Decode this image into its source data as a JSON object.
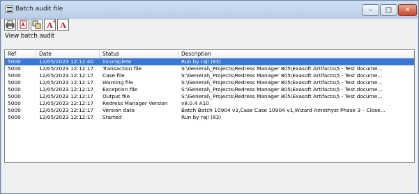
{
  "window": {
    "title": "Batch audit file"
  },
  "toolbar": {
    "buttons": [
      {
        "name": "print-button",
        "icon": "printer-icon"
      },
      {
        "name": "export-pdf-button",
        "icon": "pdf-icon"
      },
      {
        "name": "copy-button",
        "icon": "copy-icon"
      },
      {
        "name": "increase-font-button",
        "icon": "font-increase-icon",
        "glyph": "A",
        "sup": "+"
      },
      {
        "name": "decrease-font-button",
        "icon": "font-decrease-icon",
        "glyph": "A",
        "sup": "-"
      }
    ]
  },
  "caption": "View batch audit",
  "table": {
    "columns": [
      "Ref",
      "Date",
      "Status",
      "Description"
    ],
    "rows": [
      {
        "ref": "5000",
        "date": "12/05/2023 12:12:40",
        "status": "Incomplete",
        "description": "Run by raji (83)",
        "selected": true
      },
      {
        "ref": "5000",
        "date": "12/05/2023 12:12:17",
        "status": "Transaction file",
        "description": "S:\\General\\_Projects\\Redress Manager 805\\Exasoft Artifacts\\5 - Test docume…"
      },
      {
        "ref": "5000",
        "date": "12/05/2023 12:12:17",
        "status": "Case file",
        "description": "S:\\General\\_Projects\\Redress Manager 805\\Exasoft Artifacts\\5 - Test docume…"
      },
      {
        "ref": "5000",
        "date": "12/05/2023 12:12:17",
        "status": "Warning file",
        "description": "S:\\General\\_Projects\\Redress Manager 805\\Exasoft Artifacts\\5 - Test docume…"
      },
      {
        "ref": "5000",
        "date": "12/05/2023 12:12:17",
        "status": "Exception file",
        "description": "S:\\General\\_Projects\\Redress Manager 805\\Exasoft Artifacts\\5 - Test docume…"
      },
      {
        "ref": "5000",
        "date": "12/05/2023 12:12:17",
        "status": "Output file",
        "description": "S:\\General\\_Projects\\Redress Manager 805\\Exasoft Artifacts\\5 - Test docume…"
      },
      {
        "ref": "5000",
        "date": "12/05/2023 12:12:17",
        "status": "Redress Manager Version",
        "description": "v8.0.4 A10"
      },
      {
        "ref": "5000",
        "date": "12/05/2023 12:12:17",
        "status": "Version data",
        "description": "Batch Batch 10904 v3,Case Case 10904 v1,Wizard Amethyst Phase 3 – Close…"
      },
      {
        "ref": "5000",
        "date": "12/05/2023 12:12:17",
        "status": "Started",
        "description": "Run by raji (83)"
      }
    ]
  },
  "colors": {
    "selection": "#3a78d6",
    "titlebar": "#bed0e8"
  }
}
